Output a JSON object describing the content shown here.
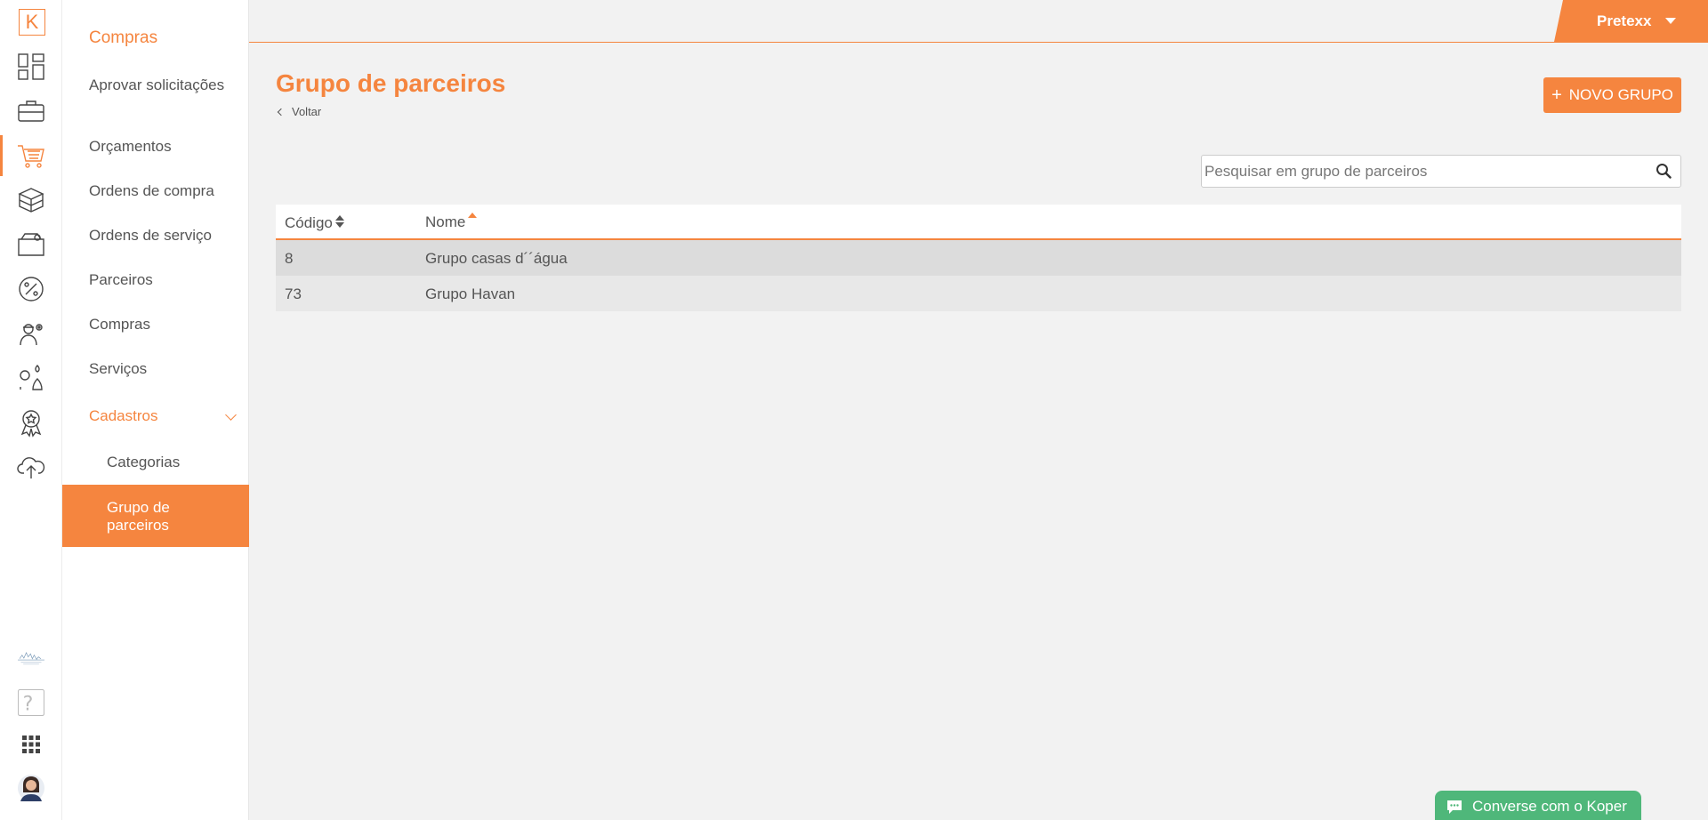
{
  "rail": {
    "logo": "K"
  },
  "sidebar": {
    "title": "Compras",
    "items": [
      {
        "label": "Aprovar solicitações"
      },
      {
        "label": "Orçamentos"
      },
      {
        "label": "Ordens de compra"
      },
      {
        "label": "Ordens de serviço"
      },
      {
        "label": "Parceiros"
      },
      {
        "label": "Compras"
      },
      {
        "label": "Serviços"
      }
    ],
    "section": "Cadastros",
    "subitems": [
      {
        "label": "Categorias"
      },
      {
        "label": "Grupo de parceiros"
      }
    ]
  },
  "topbar": {
    "user": "Pretexx"
  },
  "page": {
    "title": "Grupo de parceiros",
    "back": "Voltar",
    "new_button": "NOVO GRUPO"
  },
  "search": {
    "placeholder": "Pesquisar em grupo de parceiros"
  },
  "table": {
    "columns": [
      "Código",
      "Nome"
    ],
    "rows": [
      {
        "code": "8",
        "name": "Grupo casas d´´água"
      },
      {
        "code": "73",
        "name": "Grupo Havan"
      }
    ]
  },
  "chat": {
    "label": "Converse com o Koper"
  },
  "colors": {
    "accent": "#f5853f",
    "chat": "#4fb77a"
  }
}
